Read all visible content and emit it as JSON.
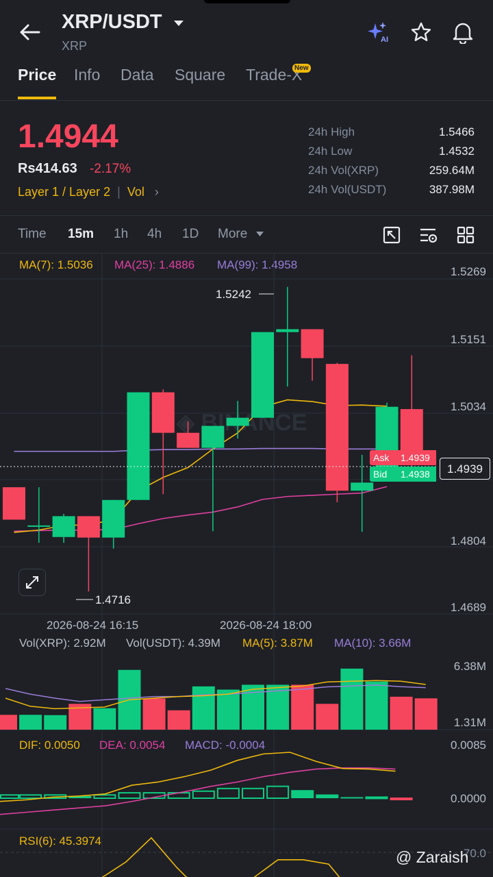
{
  "header": {
    "pair": "XRP/USDT",
    "subtitle": "XRP",
    "icons": [
      "back-arrow-icon",
      "ai-sparkle-icon",
      "star-icon",
      "bell-icon"
    ]
  },
  "tabs": [
    {
      "label": "Price",
      "active": true
    },
    {
      "label": "Info"
    },
    {
      "label": "Data"
    },
    {
      "label": "Square"
    },
    {
      "label": "Trade-X",
      "badge": "New"
    }
  ],
  "ticker": {
    "last_price": "1.4944",
    "fiat_price": "Rs414.63",
    "change": "-2.17%",
    "tag1": "Layer 1 / Layer 2",
    "tag2": "Vol",
    "stats": [
      {
        "label": "24h High",
        "value": "1.5466"
      },
      {
        "label": "24h Low",
        "value": "1.4532"
      },
      {
        "label": "24h Vol(XRP)",
        "value": "259.64M"
      },
      {
        "label": "24h Vol(USDT)",
        "value": "387.98M"
      }
    ]
  },
  "timeframes": [
    "Time",
    "15m",
    "1h",
    "4h",
    "1D",
    "More"
  ],
  "active_timeframe": "15m",
  "indicators": {
    "ma7": "MA(7): 1.5036",
    "ma25": "MA(25): 1.4886",
    "ma99": "MA(99): 1.4958",
    "vol_xrp": "Vol(XRP): 2.92M",
    "vol_usdt": "Vol(USDT): 4.39M",
    "vol_ma5": "MA(5): 3.87M",
    "vol_ma10": "MA(10): 3.66M",
    "dif": "DIF: 0.0050",
    "dea": "DEA: 0.0054",
    "macd": "MACD: -0.0004",
    "rsi": "RSI(6): 45.3974"
  },
  "axis": {
    "price_ticks": [
      "1.5269",
      "1.5151",
      "1.5034",
      "1.4804",
      "1.4689"
    ],
    "vol_ticks": [
      "6.38M",
      "1.31M"
    ],
    "macd_ticks": [
      "0.0085",
      "0.0000"
    ],
    "rsi_ticks": [
      "70.0"
    ],
    "x_labels": [
      "2026-08-24 16:15",
      "2026-08-24 18:00"
    ]
  },
  "markers": {
    "high_label": "1.5242",
    "low_label": "1.4716",
    "current_price": "1.4939",
    "ask_label": "Ask",
    "ask_value": "1.4939",
    "bid_label": "Bid",
    "bid_value": "1.4938"
  },
  "watermark": "@ Zaraish",
  "colors": {
    "up": "#0ecb81",
    "down": "#f6465d",
    "accent": "#f0b90b",
    "ma7": "#f0b90b",
    "ma25": "#e040a0",
    "ma99": "#9b7ed8"
  },
  "chart_data": {
    "type": "candlestick",
    "interval": "15m",
    "ylim": [
      1.4689,
      1.5269
    ],
    "candles": [
      {
        "o": 1.4896,
        "h": 1.4896,
        "l": 1.484,
        "c": 1.484
      },
      {
        "o": 1.483,
        "h": 1.4896,
        "l": 1.48,
        "c": 1.483
      },
      {
        "o": 1.481,
        "h": 1.485,
        "l": 1.48,
        "c": 1.4846
      },
      {
        "o": 1.4846,
        "h": 1.4846,
        "l": 1.4716,
        "c": 1.4809
      },
      {
        "o": 1.4809,
        "h": 1.4874,
        "l": 1.479,
        "c": 1.4874
      },
      {
        "o": 1.4874,
        "h": 1.506,
        "l": 1.4874,
        "c": 1.506
      },
      {
        "o": 1.506,
        "h": 1.5065,
        "l": 1.4884,
        "c": 1.499
      },
      {
        "o": 1.499,
        "h": 1.501,
        "l": 1.4964,
        "c": 1.4964
      },
      {
        "o": 1.4964,
        "h": 1.4999,
        "l": 1.482,
        "c": 1.5002
      },
      {
        "o": 1.5002,
        "h": 1.5045,
        "l": 1.498,
        "c": 1.5016
      },
      {
        "o": 1.5016,
        "h": 1.503,
        "l": 1.5016,
        "c": 1.5164
      },
      {
        "o": 1.5164,
        "h": 1.5242,
        "l": 1.507,
        "c": 1.5169
      },
      {
        "o": 1.5169,
        "h": 1.5169,
        "l": 1.508,
        "c": 1.5119
      },
      {
        "o": 1.5109,
        "h": 1.5111,
        "l": 1.487,
        "c": 1.489
      },
      {
        "o": 1.489,
        "h": 1.4952,
        "l": 1.4819,
        "c": 1.4904
      },
      {
        "o": 1.4922,
        "h": 1.5042,
        "l": 1.4906,
        "c": 1.5035
      },
      {
        "o": 1.5031,
        "h": 1.5124,
        "l": 1.4908,
        "c": 1.4944
      }
    ],
    "ma7": [
      1.4818,
      1.4822,
      1.483,
      1.4831,
      1.484,
      1.489,
      1.4913,
      1.493,
      1.4962,
      1.499,
      1.5035,
      1.5047,
      1.5044,
      1.5037,
      1.5038,
      1.5036
    ],
    "ma25": [
      1.482,
      1.4821,
      1.4822,
      1.4822,
      1.4823,
      1.4833,
      1.4842,
      1.4848,
      1.4853,
      1.4862,
      1.4875,
      1.488,
      1.4882,
      1.4884,
      1.4886,
      1.4897
    ],
    "ma99": [
      1.4958,
      1.4958,
      1.4958,
      1.4958,
      1.4958,
      1.496,
      1.4961,
      1.4961,
      1.4962,
      1.4962,
      1.4963,
      1.4963,
      1.4963,
      1.4962,
      1.4962,
      1.4962
    ],
    "volume": [
      0.92,
      0.92,
      0.9,
      1.6,
      1.33,
      3.7,
      1.93,
      1.2,
      2.68,
      2.48,
      2.78,
      2.78,
      2.78,
      1.6,
      3.78,
      2.98,
      2.04,
      1.94
    ],
    "volume_ma5": [
      1.95,
      1.45,
      1.3,
      1.35,
      1.4,
      1.85,
      1.95,
      2.05,
      2.1,
      2.2,
      2.5,
      2.6,
      2.7,
      2.95,
      3.0,
      3.04,
      3.0,
      2.8
    ],
    "volume_ma10": [
      2.55,
      2.2,
      1.95,
      1.75,
      1.85,
      1.95,
      2.05,
      2.05,
      2.15,
      2.2,
      2.3,
      2.4,
      2.5,
      2.65,
      2.7,
      2.76,
      2.66,
      2.6
    ],
    "macd_hist": [
      0.0006,
      0.0006,
      0.0006,
      0.0004,
      0.0006,
      0.001,
      0.001,
      0.001,
      0.0013,
      0.0018,
      0.0018,
      0.0022,
      0.0015,
      0.0007,
      0.0002,
      0.0002,
      -0.0002
    ],
    "dif": [
      -0.0006,
      -0.0003,
      0.0002,
      0.0004,
      0.0008,
      0.0024,
      0.003,
      0.004,
      0.0052,
      0.007,
      0.0082,
      0.0085,
      0.0068,
      0.0055,
      0.0054,
      0.005
    ],
    "dea": [
      -0.003,
      -0.0026,
      -0.0022,
      -0.0018,
      -0.0014,
      -0.0006,
      0.0003,
      0.0012,
      0.0022,
      0.003,
      0.004,
      0.0048,
      0.0054,
      0.0056,
      0.0056,
      0.0054
    ],
    "rsi6": [
      20,
      45,
      60,
      82,
      55,
      32,
      32,
      45,
      62,
      62,
      58,
      30
    ]
  }
}
